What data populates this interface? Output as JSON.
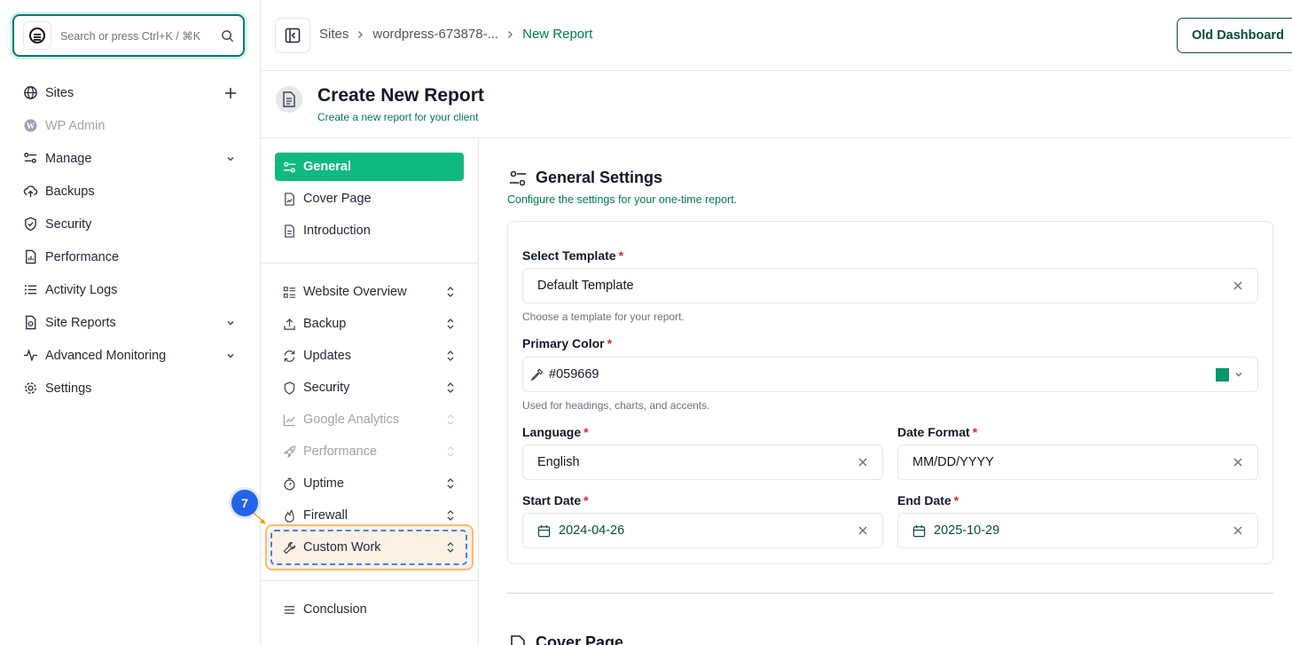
{
  "sidebar": {
    "search_placeholder": "Search or press Ctrl+K / ⌘K",
    "items": [
      {
        "label": "Sites",
        "icon": "globe-icon",
        "trail": "plus"
      },
      {
        "label": "WP Admin",
        "icon": "wordpress-icon",
        "disabled": true
      },
      {
        "label": "Manage",
        "icon": "sliders-icon",
        "trail": "chevron"
      },
      {
        "label": "Backups",
        "icon": "cloud-upload-icon"
      },
      {
        "label": "Security",
        "icon": "shield-icon"
      },
      {
        "label": "Performance",
        "icon": "file-chart-icon"
      },
      {
        "label": "Activity Logs",
        "icon": "list-icon"
      },
      {
        "label": "Site Reports",
        "icon": "file-report-icon",
        "trail": "chevron"
      },
      {
        "label": "Advanced Monitoring",
        "icon": "activity-icon",
        "trail": "chevron"
      },
      {
        "label": "Settings",
        "icon": "gear-icon"
      }
    ]
  },
  "topbar": {
    "breadcrumb": [
      "Sites",
      "wordpress-673878-...",
      "New Report"
    ],
    "old_dashboard_label": "Old Dashboard"
  },
  "page": {
    "title": "Create New Report",
    "subtitle": "Create a new report for your client"
  },
  "sections": {
    "top": [
      "General",
      "Cover Page",
      "Introduction"
    ],
    "middle": [
      {
        "label": "Website Overview",
        "disabled": false
      },
      {
        "label": "Backup",
        "disabled": false
      },
      {
        "label": "Updates",
        "disabled": false
      },
      {
        "label": "Security",
        "disabled": false
      },
      {
        "label": "Google Analytics",
        "disabled": true
      },
      {
        "label": "Performance",
        "disabled": true
      },
      {
        "label": "Uptime",
        "disabled": false
      },
      {
        "label": "Firewall",
        "disabled": false
      },
      {
        "label": "Custom Work",
        "disabled": false
      }
    ],
    "bottom": [
      "Conclusion"
    ],
    "active": "General",
    "step_badge": "7"
  },
  "general": {
    "title": "General Settings",
    "subtitle": "Configure the settings for your one-time report.",
    "template_label": "Select Template",
    "template_value": "Default Template",
    "template_help": "Choose a template for your report.",
    "color_label": "Primary Color",
    "color_value": "#059669",
    "color_help": "Used for headings, charts, and accents.",
    "language_label": "Language",
    "language_value": "English",
    "date_format_label": "Date Format",
    "date_format_value": "MM/DD/YYYY",
    "start_date_label": "Start Date",
    "start_date_value": "2024-04-26",
    "end_date_label": "End Date",
    "end_date_value": "2025-10-29",
    "required_mark": "*"
  },
  "next_section": {
    "title": "Cover Page"
  },
  "colors": {
    "accent": "#10b981",
    "brand_dark": "#064e3b",
    "link": "#047857",
    "highlight": "#fdba74",
    "badge": "#2563eb"
  }
}
